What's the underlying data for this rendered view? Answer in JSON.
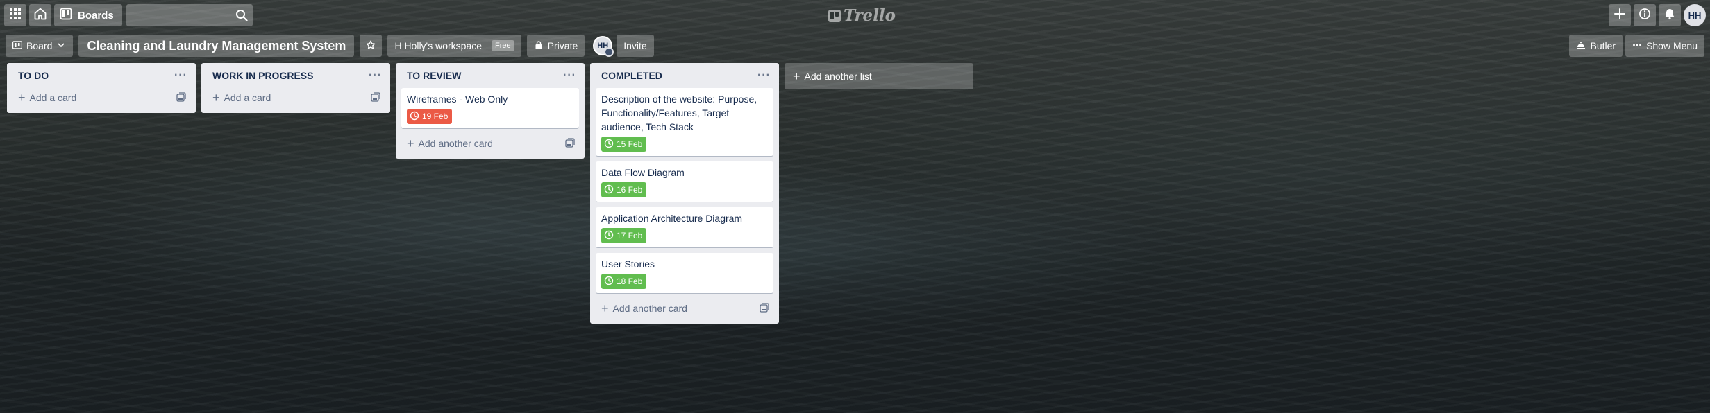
{
  "topbar": {
    "apps_icon": "grid-icon",
    "home_icon": "home-icon",
    "boards_label": "Boards",
    "search": {
      "value": "",
      "placeholder": ""
    },
    "logo_text": "Trello",
    "avatar_initials": "HH"
  },
  "board": {
    "view_label": "Board",
    "title": "Cleaning and Laundry Management System",
    "workspace_label": "H Holly's workspace",
    "workspace_badge": "Free",
    "visibility_label": "Private",
    "member_initials": "HH",
    "invite_label": "Invite",
    "butler_label": "Butler",
    "menu_label": "Show Menu"
  },
  "lists": [
    {
      "title": "TO DO",
      "menu": "···",
      "add_label": "Add a card",
      "cards": []
    },
    {
      "title": "WORK IN PROGRESS",
      "menu": "···",
      "add_label": "Add a card",
      "cards": []
    },
    {
      "title": "TO REVIEW",
      "menu": "···",
      "add_label": "Add another card",
      "cards": [
        {
          "title": "Wireframes - Web Only",
          "due": "19 Feb",
          "status": "overdue"
        }
      ]
    },
    {
      "title": "COMPLETED",
      "menu": "···",
      "add_label": "Add another card",
      "cards": [
        {
          "title": "Description of the website: Purpose, Functionality/Features, Target audience, Tech Stack",
          "due": "15 Feb",
          "status": "complete"
        },
        {
          "title": "Data Flow Diagram",
          "due": "16 Feb",
          "status": "complete"
        },
        {
          "title": "Application Architecture Diagram",
          "due": "17 Feb",
          "status": "complete"
        },
        {
          "title": "User Stories",
          "due": "18 Feb",
          "status": "complete"
        }
      ]
    }
  ],
  "add_list_label": "Add another list",
  "colors": {
    "overdue": "#eb5a46",
    "complete": "#61bd4f",
    "list_bg": "#ebecf0",
    "text": "#172b4d"
  }
}
